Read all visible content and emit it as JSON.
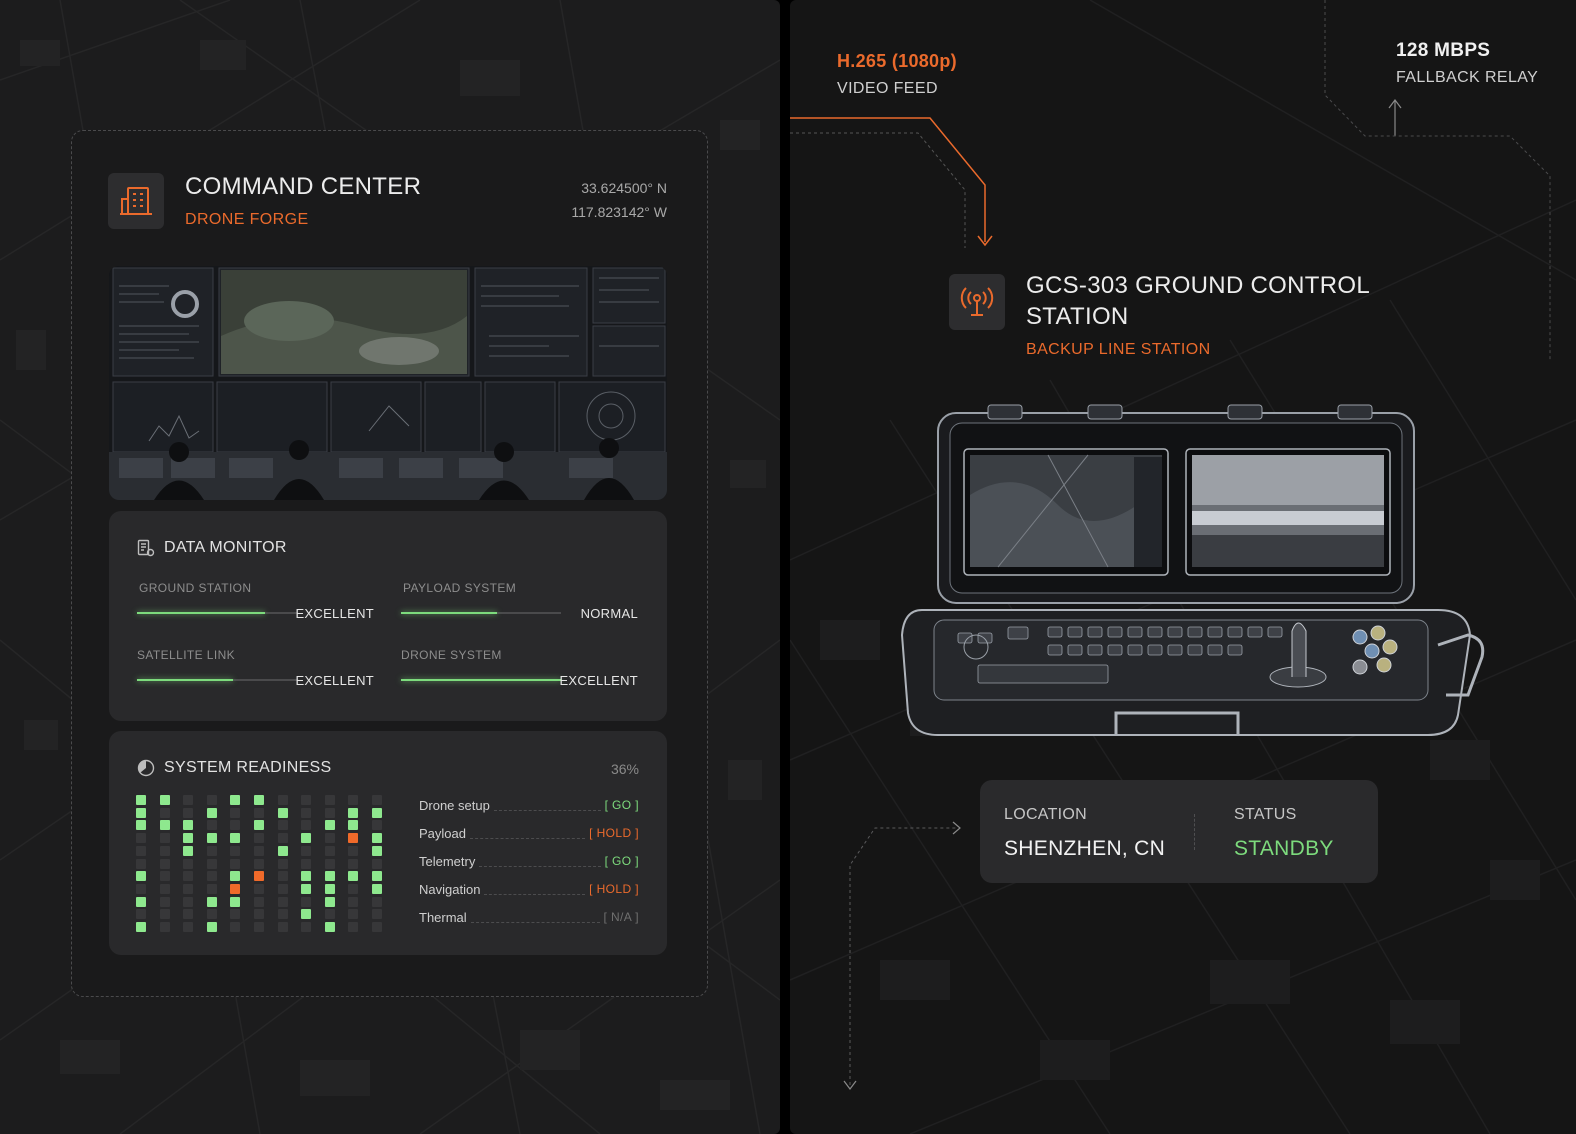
{
  "command_center": {
    "title": "COMMAND CENTER",
    "subtitle": "DRONE FORGE",
    "latitude": "33.624500° N",
    "longitude": "117.823142° W",
    "icon": "building-icon"
  },
  "data_monitor": {
    "title": "DATA MONITOR",
    "icon": "database-monitor-icon",
    "metrics": [
      {
        "label": "GROUND STATION",
        "value": "EXCELLENT",
        "level": 0.8
      },
      {
        "label": "PAYLOAD SYSTEM",
        "value": "NORMAL",
        "level": 0.6
      },
      {
        "label": "SATELLITE LINK",
        "value": "EXCELLENT",
        "level": 0.6
      },
      {
        "label": "DRONE SYSTEM",
        "value": "EXCELLENT",
        "level": 1.0
      }
    ],
    "accent_color": "#7ddb7d"
  },
  "system_readiness": {
    "title": "SYSTEM READINESS",
    "icon": "pie-progress-icon",
    "percent": "36%",
    "checklist": [
      {
        "name": "Drone setup",
        "state": "[ GO ]",
        "status": "go"
      },
      {
        "name": "Payload",
        "state": "[ HOLD ]",
        "status": "hold"
      },
      {
        "name": "Telemetry",
        "state": "[ GO ]",
        "status": "go"
      },
      {
        "name": "Navigation",
        "state": "[ HOLD ]",
        "status": "hold"
      },
      {
        "name": "Thermal",
        "state": "[ N/A ]",
        "status": "na"
      }
    ]
  },
  "video_feed": {
    "value": "H.265 (1080p)",
    "label": "VIDEO FEED"
  },
  "fallback_relay": {
    "value": "128 MBPS",
    "label": "FALLBACK RELAY"
  },
  "ground_station": {
    "title": "GCS-303 GROUND CONTROL STATION",
    "subtitle": "BACKUP LINE STATION",
    "icon": "antenna-signal-icon"
  },
  "location_card": {
    "location_label": "LOCATION",
    "location_value": "SHENZHEN, CN",
    "status_label": "STATUS",
    "status_value": "STANDBY"
  },
  "colors": {
    "accent_orange": "#ea6a2c",
    "accent_green": "#7ddb7d",
    "card": "#2a2a2c"
  }
}
